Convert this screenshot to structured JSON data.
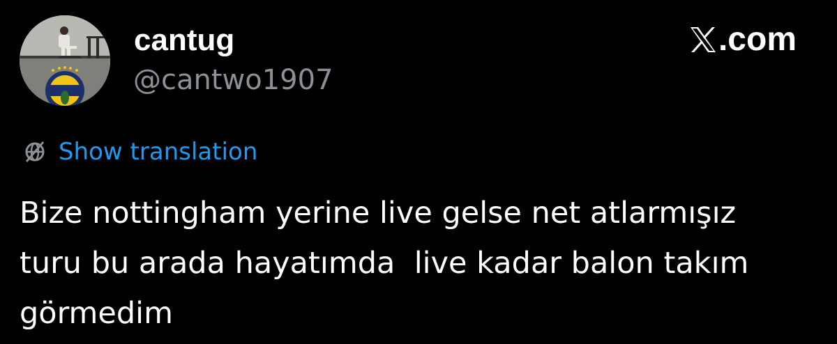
{
  "author": {
    "display_name": "cantug",
    "handle": "@cantwo1907"
  },
  "brand": {
    "label": ".com",
    "icon": "x-logo-icon"
  },
  "translation": {
    "icon": "translate-globe-icon",
    "label": "Show translation",
    "color": "#1d9bf0"
  },
  "tweet": {
    "line1": "Bize nottingham yerine live gelse net atlarmışız",
    "line2": "turu bu arada hayatımda  live kadar balon takım",
    "line3": "görmedim"
  },
  "theme": {
    "background": "#000000",
    "text_primary": "#ffffff",
    "text_secondary": "#8b9197"
  }
}
